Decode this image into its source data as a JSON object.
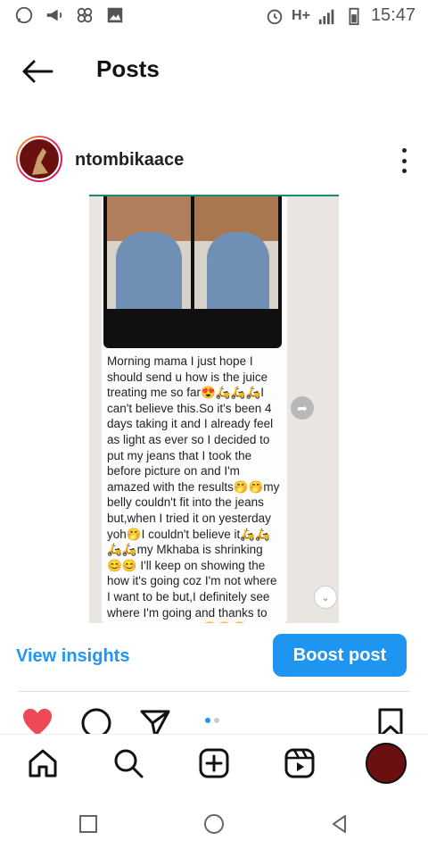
{
  "status_bar": {
    "time": "15:47",
    "network": "H+",
    "icons": [
      "whatsapp-icon",
      "megaphone-icon",
      "pinwheel-icon",
      "gallery-icon",
      "alarm-icon",
      "signal-icon",
      "battery-icon"
    ]
  },
  "header": {
    "title": "Posts",
    "back_icon": "arrow-left-icon"
  },
  "post": {
    "username": "ntombikaace",
    "message": "Morning mama I just hope I should send u how is the juice treating me so far😍🛵🛵🛵I can't believe this.So it's been 4 days taking it and I already feel as light as ever so I decided to put my jeans that I took the before picture on and I'm amazed with the results🤭🤭my belly couldn't fit into the jeans but,when I tried it on yesterday yoh🤭I couldn't believe it🛵🛵🛵🛵my Mkhaba is shrinking 😊😊 I'll keep on showing the how it's going coz I'm not where I want to be but,I definitely see where I'm going and thanks to #slenderbyntombi😍😍😍"
  },
  "insights": {
    "view_label": "View insights",
    "boost_label": "Boost post"
  },
  "carousel": {
    "active": 1,
    "total": 2
  },
  "colors": {
    "accent": "#1e95f1",
    "link": "#2196f3",
    "like": "#ed4956"
  }
}
